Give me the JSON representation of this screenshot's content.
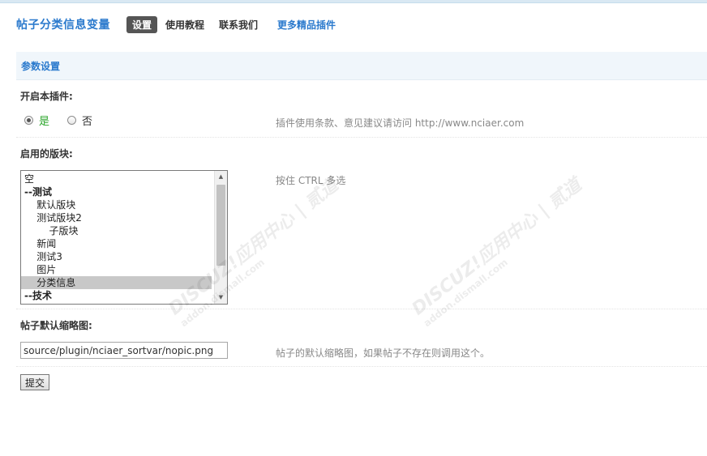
{
  "header": {
    "title": "帖子分类信息变量",
    "nav": [
      {
        "label": "设置",
        "active": true
      },
      {
        "label": "使用教程"
      },
      {
        "label": "联系我们"
      },
      {
        "label": "更多精品插件",
        "link": true
      }
    ]
  },
  "section": {
    "title": "参数设置"
  },
  "enable_plugin": {
    "label": "开启本插件:",
    "options": [
      {
        "label": "是",
        "checked": true
      },
      {
        "label": "否",
        "checked": false
      }
    ],
    "hint": "插件使用条款、意见建议请访问 http://www.nciaer.com"
  },
  "forums": {
    "label": "启用的版块:",
    "hint": "按住 CTRL 多选",
    "items": [
      {
        "text": "空"
      },
      {
        "text": "--测试",
        "group": true
      },
      {
        "text": "    默认版块"
      },
      {
        "text": "    测试版块2"
      },
      {
        "text": "        子版块"
      },
      {
        "text": "    新闻"
      },
      {
        "text": "    测试3"
      },
      {
        "text": "    图片"
      },
      {
        "text": "    分类信息",
        "selected": true
      },
      {
        "text": "--技术",
        "group": true
      }
    ]
  },
  "thumbnail": {
    "label": "帖子默认缩略图:",
    "value": "source/plugin/nciaer_sortvar/nopic.png",
    "hint": "帖子的默认缩略图，如果帖子不存在则调用这个。"
  },
  "submit_label": "提交",
  "watermark": {
    "brand": "DISCUZ!应用中心 | 贰道",
    "url": "addon.dismall.com"
  },
  "colors": {
    "accent": "#2b7acd",
    "section_bg": "#f0f6fb",
    "yes_green": "#2aa52a"
  }
}
